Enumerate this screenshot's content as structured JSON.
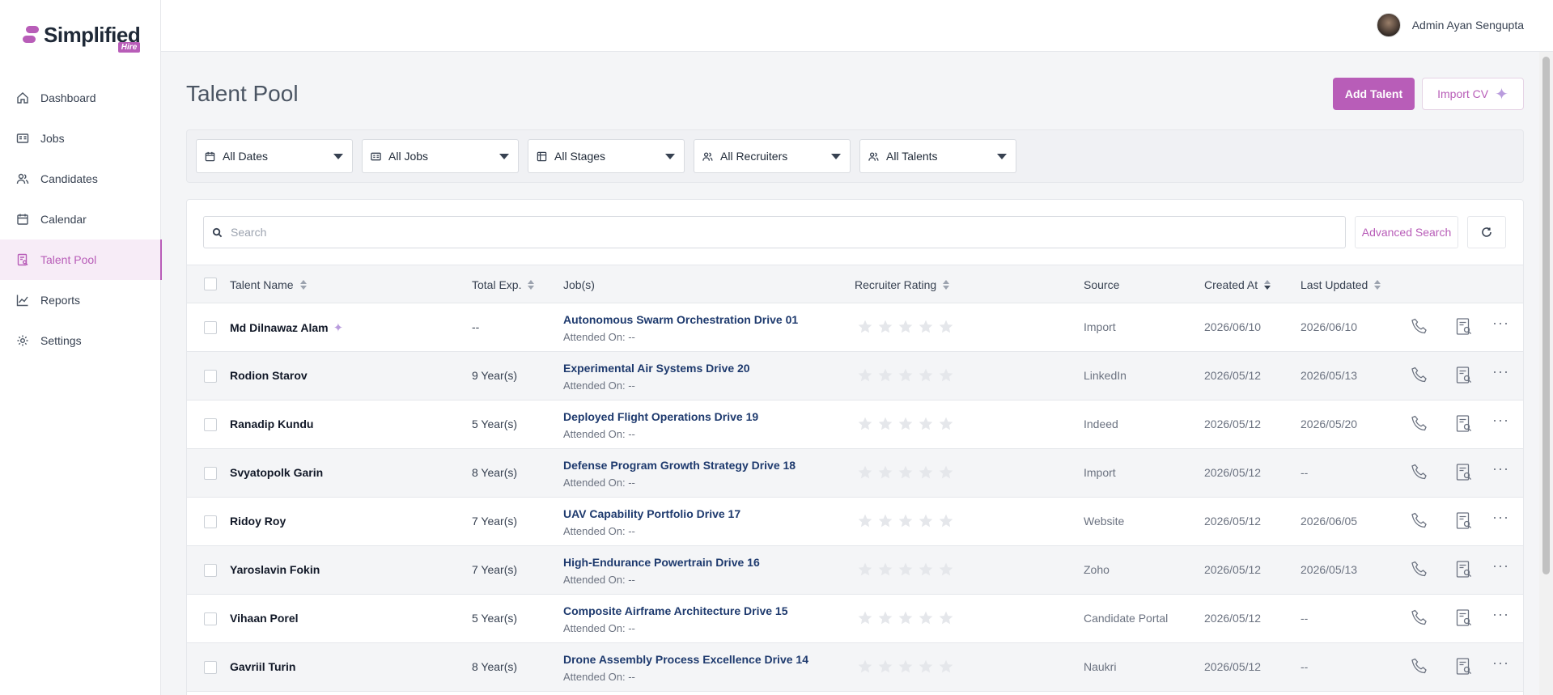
{
  "brand": {
    "name": "Simplified",
    "sub": "Hire"
  },
  "sidebar": {
    "items": [
      {
        "label": "Dashboard",
        "icon": "home-icon"
      },
      {
        "label": "Jobs",
        "icon": "id-card-icon"
      },
      {
        "label": "Candidates",
        "icon": "users-icon"
      },
      {
        "label": "Calendar",
        "icon": "calendar-icon"
      },
      {
        "label": "Talent Pool",
        "icon": "talent-pool-icon",
        "active": true
      },
      {
        "label": "Reports",
        "icon": "chart-line-icon"
      },
      {
        "label": "Settings",
        "icon": "gear-icon"
      }
    ]
  },
  "header": {
    "user_name": "Admin Ayan Sengupta"
  },
  "page": {
    "title": "Talent Pool",
    "add_label": "Add Talent",
    "import_label": "Import CV"
  },
  "filters": {
    "dates": "All Dates",
    "jobs": "All Jobs",
    "stages": "All Stages",
    "recruiters": "All Recruiters",
    "talents": "All Talents"
  },
  "search": {
    "placeholder": "Search",
    "advanced_label": "Advanced Search"
  },
  "table": {
    "columns": {
      "name": "Talent Name",
      "exp": "Total Exp.",
      "jobs": "Job(s)",
      "rating": "Recruiter Rating",
      "source": "Source",
      "created": "Created At",
      "updated": "Last Updated"
    },
    "rows": [
      {
        "name": "Md Dilnawaz Alam",
        "ai": true,
        "exp": "--",
        "job": "Autonomous Swarm Orchestration Drive 01",
        "attended": "Attended On: --",
        "rating": 0,
        "source": "Import",
        "created": "2026/06/10",
        "updated": "2026/06/10"
      },
      {
        "name": "Rodion Starov",
        "exp": "9 Year(s)",
        "job": "Experimental Air Systems Drive 20",
        "attended": "Attended On: --",
        "rating": 0,
        "source": "LinkedIn",
        "created": "2026/05/12",
        "updated": "2026/05/13"
      },
      {
        "name": "Ranadip Kundu",
        "exp": "5 Year(s)",
        "job": "Deployed Flight Operations Drive 19",
        "attended": "Attended On: --",
        "rating": 0,
        "source": "Indeed",
        "created": "2026/05/12",
        "updated": "2026/05/20"
      },
      {
        "name": "Svyatopolk Garin",
        "exp": "8 Year(s)",
        "job": "Defense Program Growth Strategy Drive 18",
        "attended": "Attended On: --",
        "rating": 0,
        "source": "Import",
        "created": "2026/05/12",
        "updated": "--"
      },
      {
        "name": "Ridoy Roy",
        "exp": "7 Year(s)",
        "job": "UAV Capability Portfolio Drive 17",
        "attended": "Attended On: --",
        "rating": 0,
        "source": "Website",
        "created": "2026/05/12",
        "updated": "2026/06/05"
      },
      {
        "name": "Yaroslavin Fokin",
        "exp": "7 Year(s)",
        "job": "High-Endurance Powertrain Drive 16",
        "attended": "Attended On: --",
        "rating": 0,
        "source": "Zoho",
        "created": "2026/05/12",
        "updated": "2026/05/13"
      },
      {
        "name": "Vihaan Porel",
        "exp": "5 Year(s)",
        "job": "Composite Airframe Architecture Drive 15",
        "attended": "Attended On: --",
        "rating": 0,
        "source": "Candidate Portal",
        "created": "2026/05/12",
        "updated": "--"
      },
      {
        "name": "Gavriil Turin",
        "exp": "8 Year(s)",
        "job": "Drone Assembly Process Excellence Drive 14",
        "attended": "Attended On: --",
        "rating": 0,
        "source": "Naukri",
        "created": "2026/05/12",
        "updated": "--"
      }
    ]
  },
  "colors": {
    "accent": "#b85db8",
    "job_link": "#1e3a6e",
    "star_empty": "#e5e7eb"
  }
}
